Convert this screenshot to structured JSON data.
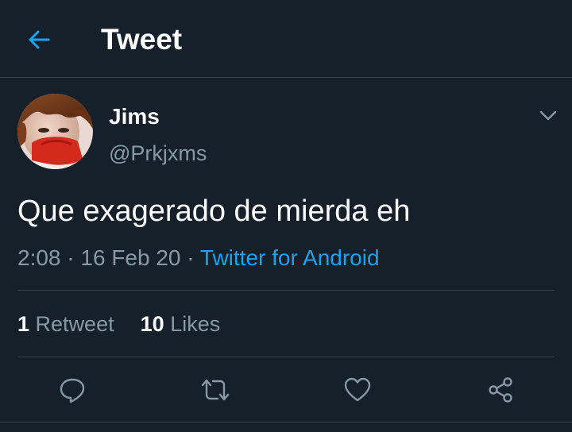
{
  "header": {
    "back_icon": "arrow-left-icon",
    "title": "Tweet",
    "accent_color": "#1da1f2"
  },
  "tweet": {
    "author": {
      "display_name": "Jims",
      "handle": "@Prkjxms"
    },
    "text": "Que exagerado de mierda eh",
    "time": "2:08",
    "date": "16 Feb 20",
    "separator": "·",
    "source": "Twitter for Android",
    "menu_icon": "chevron-down-icon"
  },
  "stats": {
    "retweets_count": "1",
    "retweets_label": "Retweet",
    "likes_count": "10",
    "likes_label": "Likes"
  },
  "actions": [
    {
      "name": "reply",
      "icon": "reply-icon"
    },
    {
      "name": "retweet",
      "icon": "retweet-icon"
    },
    {
      "name": "like",
      "icon": "heart-icon"
    },
    {
      "name": "share",
      "icon": "share-icon"
    }
  ],
  "colors": {
    "background": "#15202b",
    "secondary_text": "#8899a6",
    "divider": "#38444d",
    "link": "#1da1f2"
  }
}
